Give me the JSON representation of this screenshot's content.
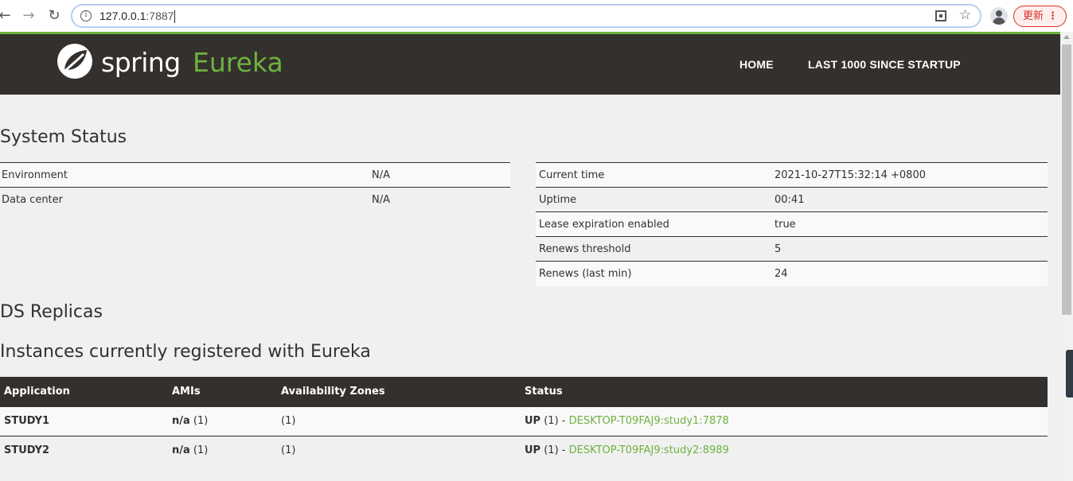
{
  "browser": {
    "url_host": "127.0.0.1",
    "url_port": ":7887",
    "update_label": "更新"
  },
  "header": {
    "logo_spring": "spring",
    "logo_eureka": "Eureka",
    "nav_home": "HOME",
    "nav_last": "LAST 1000 SINCE STARTUP"
  },
  "sections": {
    "system_status": "System Status",
    "ds_replicas": "DS Replicas",
    "instances": "Instances currently registered with Eureka"
  },
  "system_left": [
    {
      "key": "Environment",
      "value": "N/A"
    },
    {
      "key": "Data center",
      "value": "N/A"
    }
  ],
  "system_right": [
    {
      "key": "Current time",
      "value": "2021-10-27T15:32:14 +0800"
    },
    {
      "key": "Uptime",
      "value": "00:41"
    },
    {
      "key": "Lease expiration enabled",
      "value": "true"
    },
    {
      "key": "Renews threshold",
      "value": "5"
    },
    {
      "key": "Renews (last min)",
      "value": "24"
    }
  ],
  "instances": {
    "columns": [
      "Application",
      "AMIs",
      "Availability Zones",
      "Status"
    ],
    "rows": [
      {
        "application": "STUDY1",
        "ami": "n/a",
        "ami_count": "(1)",
        "zones": "(1)",
        "status": "UP",
        "status_count": "(1) -",
        "instance": "DESKTOP-T09FAJ9:study1:7878"
      },
      {
        "application": "STUDY2",
        "ami": "n/a",
        "ami_count": "(1)",
        "zones": "(1)",
        "status": "UP",
        "status_count": "(1) -",
        "instance": "DESKTOP-T09FAJ9:study2:8989"
      }
    ]
  },
  "colors": {
    "brand_green": "#6db33f",
    "navbar_dark": "#34302d"
  }
}
